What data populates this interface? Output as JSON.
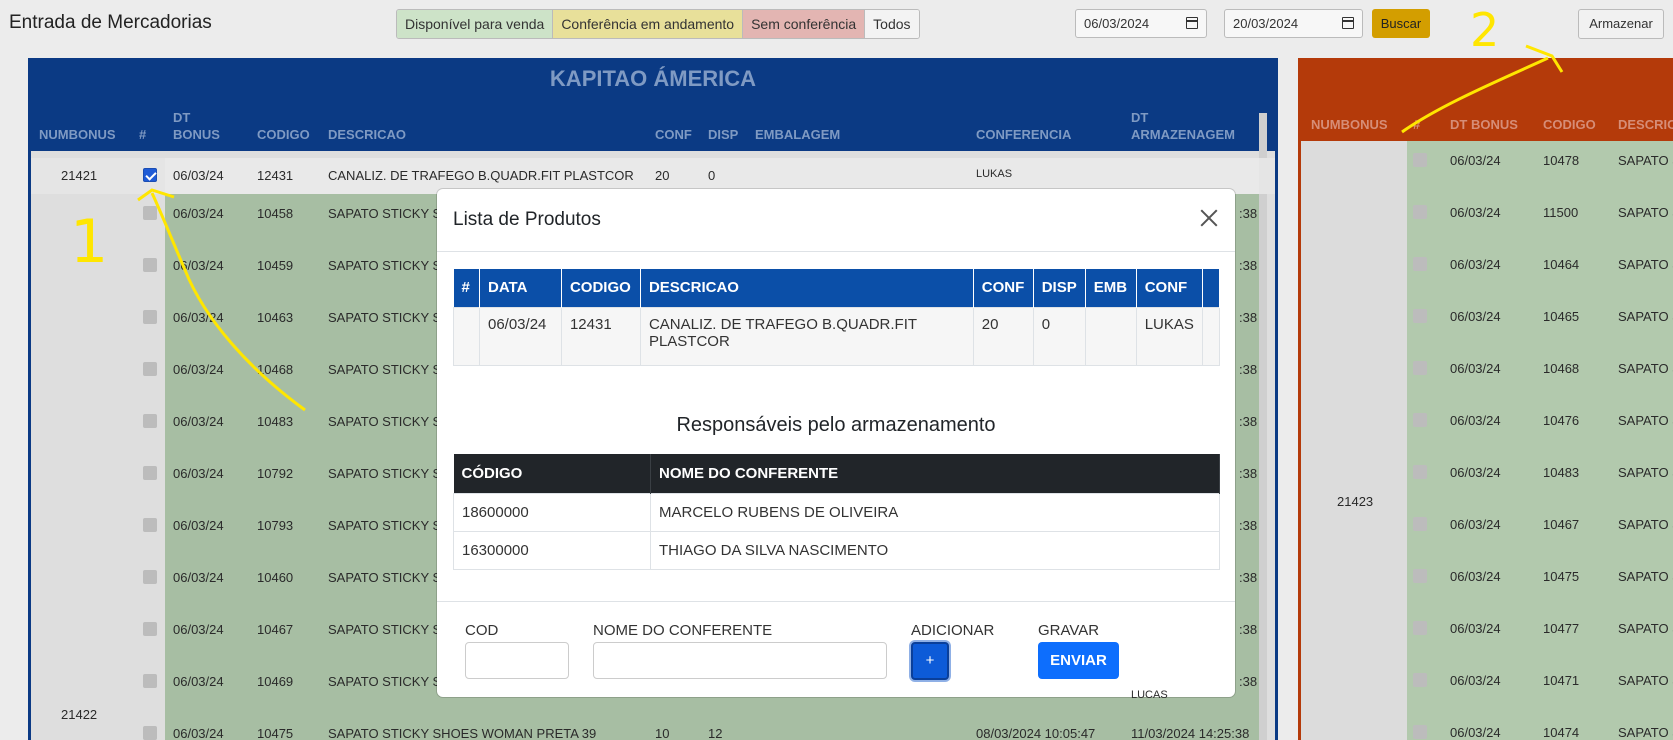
{
  "app": {
    "title": "Entrada de Mercadorias"
  },
  "filters": {
    "available": "Disponível para venda",
    "in_progress": "Conferência em andamento",
    "no_check": "Sem conferência",
    "all": "Todos"
  },
  "dates": {
    "from": "06/03/2024",
    "to": "20/03/2024"
  },
  "buttons": {
    "search": "Buscar",
    "store": "Armazenar"
  },
  "left_panel": {
    "title": "KAPITAO ÁMERICA",
    "headers": {
      "numbonus": "NUMBONUS",
      "hash": "#",
      "dt_bonus_1": "DT",
      "dt_bonus_2": "BONUS",
      "codigo": "CODIGO",
      "descricao": "DESCRICAO",
      "conf": "CONF",
      "disp": "DISP",
      "embalagem": "EMBALAGEM",
      "conferencia": "CONFERENCIA",
      "dt_arm_1": "DT",
      "dt_arm_2": "ARMAZENAGEM"
    },
    "first_row": {
      "numbonus": "21421",
      "date": "06/03/24",
      "code": "12431",
      "desc": "CANALIZ. DE TRAFEGO B.QUADR.FIT PLASTCOR",
      "conf": "20",
      "disp": "0",
      "conferencia": "LUKAS"
    },
    "rows": [
      {
        "date": "06/03/24",
        "code": "10458",
        "desc": "SAPATO STICKY S",
        "arm": ":38"
      },
      {
        "date": "06/03/24",
        "code": "10459",
        "desc": "SAPATO STICKY S",
        "arm": ":38"
      },
      {
        "date": "06/03/24",
        "code": "10463",
        "desc": "SAPATO STICKY S",
        "arm": ":38"
      },
      {
        "date": "06/03/24",
        "code": "10468",
        "desc": "SAPATO STICKY S",
        "arm": ":38"
      },
      {
        "date": "06/03/24",
        "code": "10483",
        "desc": "SAPATO STICKY S",
        "arm": ":38"
      },
      {
        "date": "06/03/24",
        "code": "10792",
        "desc": "SAPATO STICKY S",
        "arm": ":38"
      },
      {
        "date": "06/03/24",
        "code": "10793",
        "desc": "SAPATO STICKY S",
        "arm": ":38"
      },
      {
        "date": "06/03/24",
        "code": "10460",
        "desc": "SAPATO STICKY S",
        "arm": ":38"
      },
      {
        "date": "06/03/24",
        "code": "10467",
        "desc": "SAPATO STICKY S",
        "arm": ":38"
      },
      {
        "date": "06/03/24",
        "code": "10469",
        "desc": "SAPATO STICKY S",
        "arm": ":38"
      }
    ],
    "partial_lukas": "LUCAS",
    "second_numbonus": "21422",
    "last_row": {
      "date": "06/03/24",
      "code": "10475",
      "desc": "SAPATO STICKY SHOES WOMAN PRETA 39",
      "conf": "10",
      "disp": "12",
      "conferencia": "08/03/2024 10:05:47",
      "arm": "11/03/2024 14:25:38"
    }
  },
  "right_panel": {
    "headers": {
      "numbonus": "NUMBONUS",
      "hash": "#",
      "dt_bonus": "DT BONUS",
      "codigo": "CODIGO",
      "descricao": "DESCRIC"
    },
    "numbonus": "21423",
    "rows": [
      {
        "date": "06/03/24",
        "code": "10478",
        "desc": "SAPATO S"
      },
      {
        "date": "06/03/24",
        "code": "11500",
        "desc": "SAPATO S"
      },
      {
        "date": "06/03/24",
        "code": "10464",
        "desc": "SAPATO S"
      },
      {
        "date": "06/03/24",
        "code": "10465",
        "desc": "SAPATO S"
      },
      {
        "date": "06/03/24",
        "code": "10468",
        "desc": "SAPATO S"
      },
      {
        "date": "06/03/24",
        "code": "10476",
        "desc": "SAPATO S"
      },
      {
        "date": "06/03/24",
        "code": "10483",
        "desc": "SAPATO S"
      },
      {
        "date": "06/03/24",
        "code": "10467",
        "desc": "SAPATO S"
      },
      {
        "date": "06/03/24",
        "code": "10475",
        "desc": "SAPATO S"
      },
      {
        "date": "06/03/24",
        "code": "10477",
        "desc": "SAPATO S"
      },
      {
        "date": "06/03/24",
        "code": "10471",
        "desc": "SAPATO S"
      },
      {
        "date": "06/03/24",
        "code": "10474",
        "desc": "SAPATO S"
      }
    ]
  },
  "modal": {
    "title": "Lista de Produtos",
    "product_headers": [
      "#",
      "DATA",
      "CODIGO",
      "DESCRICAO",
      "CONF",
      "DISP",
      "EMB",
      "CONF"
    ],
    "product_row": {
      "hash": "",
      "date": "06/03/24",
      "code": "12431",
      "desc": "CANALIZ. DE TRAFEGO B.QUADR.FIT PLASTCOR",
      "conf": "20",
      "disp": "0",
      "emb": "",
      "conf2": "LUKAS"
    },
    "responsible_title": "Responsáveis pelo armazenamento",
    "responsible_headers": {
      "code": "CÓDIGO",
      "name": "NOME DO CONFERENTE"
    },
    "responsibles": [
      {
        "code": "18600000",
        "name": "MARCELO RUBENS DE OLIVEIRA"
      },
      {
        "code": "16300000",
        "name": "THIAGO DA SILVA NASCIMENTO"
      }
    ],
    "form": {
      "cod_label": "COD",
      "name_label": "NOME DO CONFERENTE",
      "add_label": "ADICIONAR",
      "add_button": "+",
      "save_label": "GRAVAR",
      "send_button": "ENVIAR"
    }
  },
  "annotations": {
    "one": "1",
    "two": "2"
  },
  "colors": {
    "left_header": "#0b3a84",
    "right_header": "#b43a0a",
    "annotation": "#ffe600",
    "primary": "#0d6efd"
  }
}
